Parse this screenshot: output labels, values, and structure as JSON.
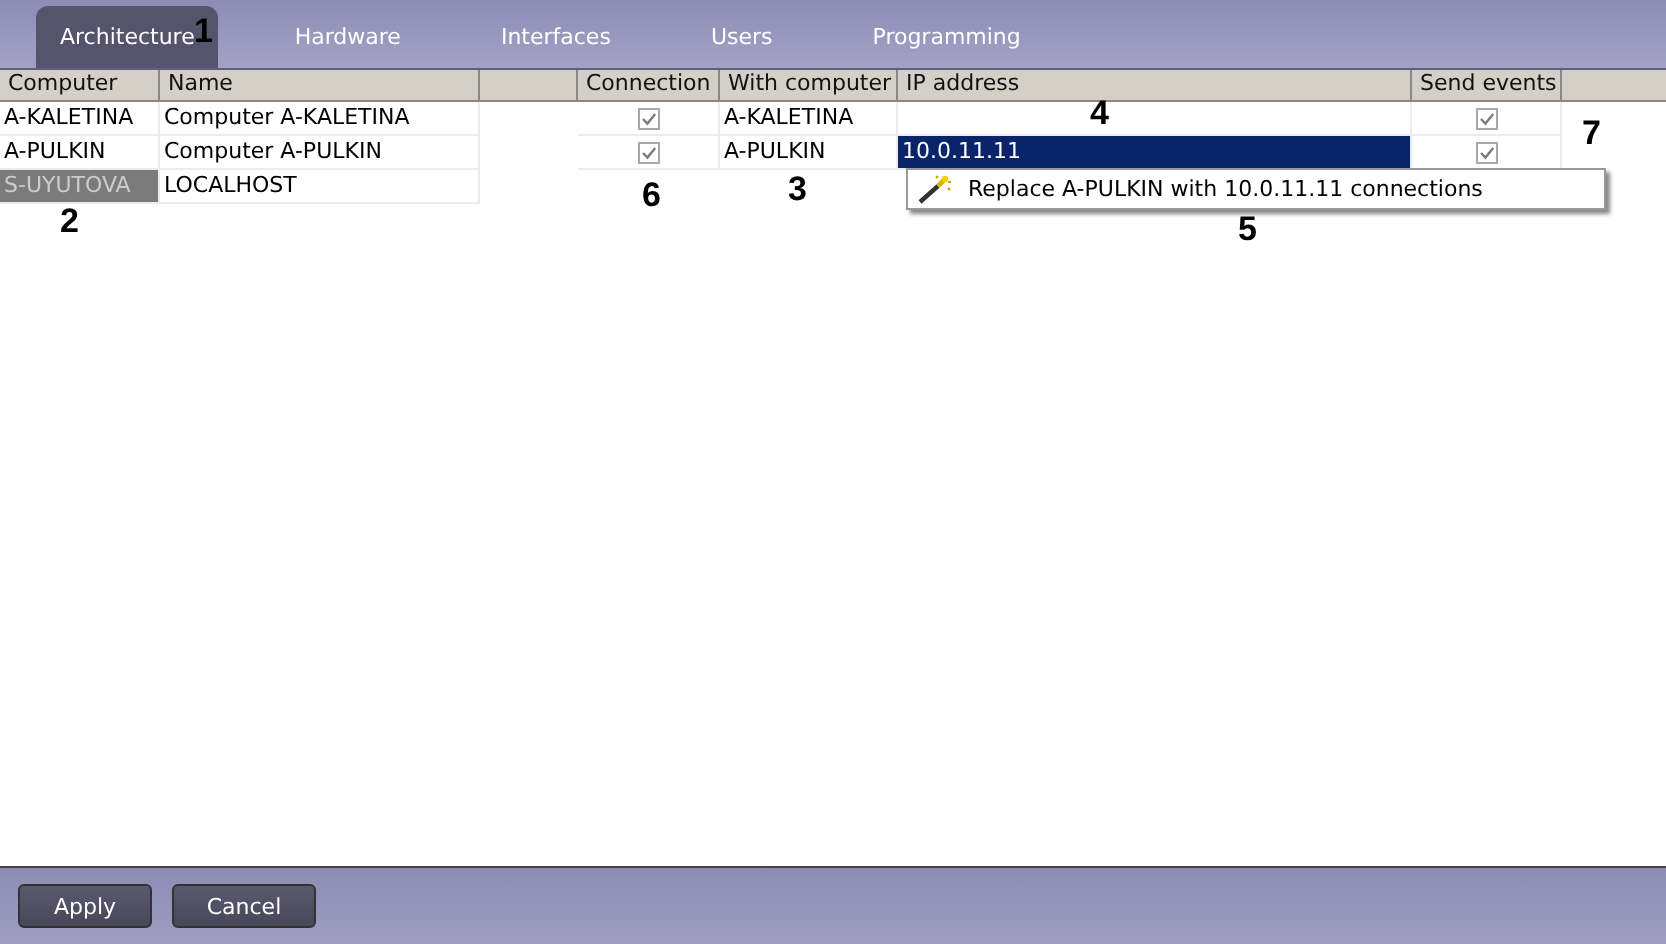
{
  "tabs": [
    {
      "label": "Architecture",
      "selected": true
    },
    {
      "label": "Hardware",
      "selected": false
    },
    {
      "label": "Interfaces",
      "selected": false
    },
    {
      "label": "Users",
      "selected": false
    },
    {
      "label": "Programming",
      "selected": false
    }
  ],
  "table": {
    "columns": [
      "Computer",
      "Name",
      "Connection",
      "With computer",
      "IP address",
      "Send events"
    ],
    "rows": [
      {
        "computer": "A-KALETINA",
        "name": "Computer A-KALETINA",
        "selected": false,
        "connection": true,
        "with_computer": "A-KALETINA",
        "ip_selected": false,
        "send_events": true
      },
      {
        "computer": "A-PULKIN",
        "name": "Computer A-PULKIN",
        "selected": false,
        "connection": true,
        "with_computer": "A-PULKIN",
        "ip_address": "10.0.11.11",
        "ip_selected": true,
        "send_events": true
      },
      {
        "computer": "S-UYUTOVA",
        "name": "LOCALHOST",
        "selected": true
      }
    ]
  },
  "context_menu": {
    "items": [
      "Replace A-PULKIN with 10.0.11.11 connections"
    ]
  },
  "callouts": [
    "1",
    "2",
    "3",
    "4",
    "5",
    "6",
    "7"
  ],
  "buttons": [
    "Apply",
    "Cancel"
  ]
}
